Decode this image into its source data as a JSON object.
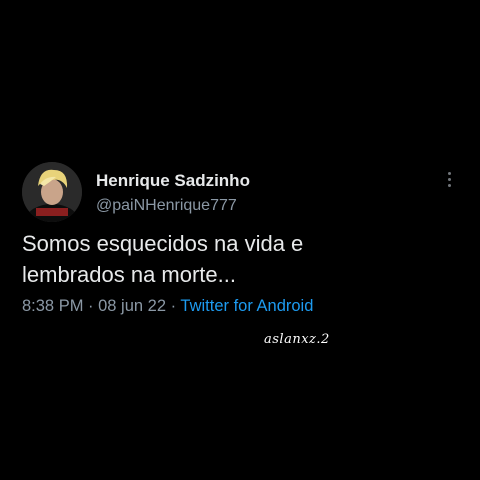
{
  "tweet": {
    "author": {
      "display_name": "Henrique Sadzinho",
      "handle": "@paiNHenrique777",
      "avatar_icon": "profile-avatar"
    },
    "text": "Somos esquecidos na vida e\nlembrados na morte...",
    "time": "8:38 PM",
    "date": "08 jun 22",
    "source": "Twitter for Android",
    "separator": " · ",
    "more_icon": "more-vertical-icon"
  },
  "watermark": "aslanxz.2",
  "colors": {
    "background": "#000000",
    "primary_text": "#e7e9ea",
    "secondary_text": "#8b98a5",
    "link": "#1d9bf0"
  }
}
